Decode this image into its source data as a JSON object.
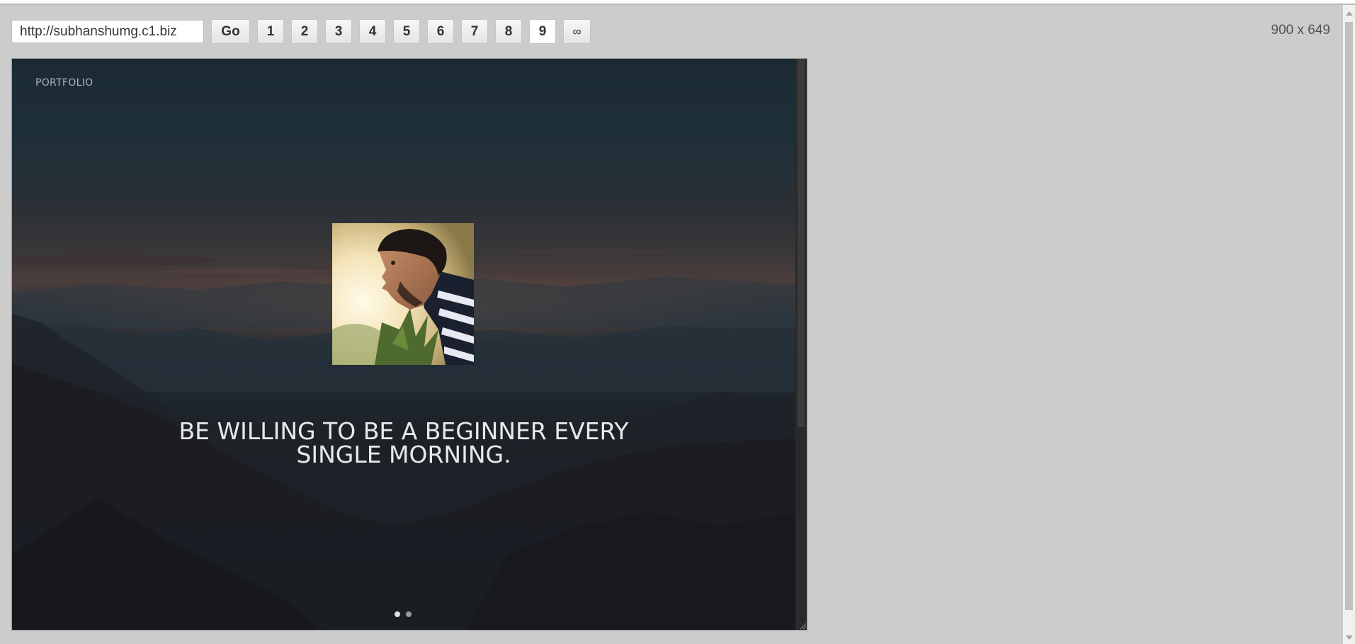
{
  "toolbar": {
    "url_value": "http://subhanshumg.c1.biz",
    "go_label": "Go",
    "size_buttons": [
      {
        "label": "1"
      },
      {
        "label": "2"
      },
      {
        "label": "3"
      },
      {
        "label": "4"
      },
      {
        "label": "5"
      },
      {
        "label": "6"
      },
      {
        "label": "7"
      },
      {
        "label": "8"
      },
      {
        "label": "9",
        "active": true
      },
      {
        "label": "∞"
      }
    ],
    "viewport_size": "900 x 649"
  },
  "site": {
    "brand": "PORTFOLIO",
    "quote_line_1": "BE WILLING TO BE A BEGINNER EVERY",
    "quote_line_2": "SINGLE MORNING.",
    "slider": {
      "slide_count": 2,
      "active_index": 0
    }
  },
  "colors": {
    "page_background": "#cccccc",
    "hero_sky_top": "#1b2a33",
    "hero_sunset_glow": "#4a3d3c",
    "hero_bottom": "#191a1f",
    "quote_text": "#e9e9ea",
    "brand_text": "#aeb4b8"
  },
  "icons": {
    "avatar": "profile-photo"
  }
}
